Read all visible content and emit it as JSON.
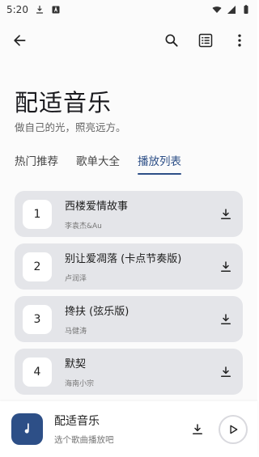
{
  "status_bar": {
    "time": "5:20",
    "icons": [
      "download-icon",
      "a-box-icon",
      "wifi-icon",
      "signal-icon",
      "battery-icon"
    ]
  },
  "appbar": {
    "back_icon": "arrow-left-icon",
    "search_icon": "search-icon",
    "list_icon": "list-icon",
    "more_icon": "more-vertical-icon"
  },
  "header": {
    "title": "配适音乐",
    "subtitle": "做自己的光，照亮远方。"
  },
  "tabs": [
    {
      "label": "热门推荐",
      "active": false
    },
    {
      "label": "歌单大全",
      "active": false
    },
    {
      "label": "播放列表",
      "active": true
    }
  ],
  "songs": [
    {
      "index": "1",
      "title": "西楼爱情故事",
      "artist": "李袁杰&Au"
    },
    {
      "index": "2",
      "title": "别让爱凋落 (卡点节奏版)",
      "artist": "卢润泽"
    },
    {
      "index": "3",
      "title": "搀扶 (弦乐版)",
      "artist": "马健涛"
    },
    {
      "index": "4",
      "title": "默契",
      "artist": "海南小宗"
    }
  ],
  "player": {
    "title": "配适音乐",
    "subtitle": "选个歌曲播放吧",
    "cover_icon": "music-note-icon",
    "download_icon": "download-icon",
    "play_icon": "play-icon"
  },
  "colors": {
    "accent": "#2d4f87",
    "card_bg": "#e4e5e9",
    "text": "#1d1d1d",
    "muted": "#777777"
  }
}
